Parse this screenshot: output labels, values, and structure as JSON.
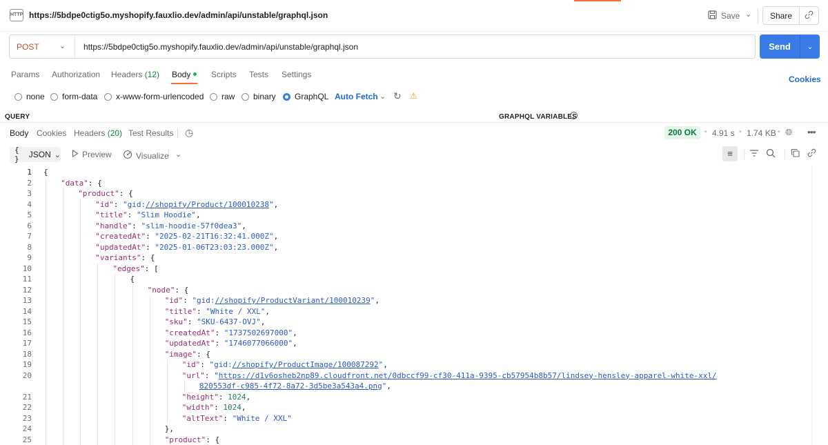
{
  "tab": {
    "icon_label": "HTTP",
    "title": "https://5bdpe0ctig5o.myshopify.fauxlio.dev/admin/api/unstable/graphql.json",
    "save_label": "Save",
    "share_label": "Share"
  },
  "request": {
    "method": "POST",
    "url": "https://5bdpe0ctig5o.myshopify.fauxlio.dev/admin/api/unstable/graphql.json",
    "send_label": "Send",
    "tabs": [
      {
        "label": "Params",
        "count": ""
      },
      {
        "label": "Authorization",
        "count": ""
      },
      {
        "label": "Headers",
        "count": "(12)"
      },
      {
        "label": "Body",
        "count": ""
      },
      {
        "label": "Scripts",
        "count": ""
      },
      {
        "label": "Tests",
        "count": ""
      },
      {
        "label": "Settings",
        "count": ""
      }
    ],
    "cookies_label": "Cookies",
    "body_types": [
      "none",
      "form-data",
      "x-www-form-urlencoded",
      "raw",
      "binary",
      "GraphQL"
    ],
    "selected_body_type": "GraphQL",
    "auto_fetch_label": "Auto Fetch"
  },
  "sections": {
    "query": "QUERY",
    "graphql_variables": "GRAPHQL VARIABLES"
  },
  "response": {
    "tabs": [
      {
        "label": "Body",
        "count": ""
      },
      {
        "label": "Cookies",
        "count": ""
      },
      {
        "label": "Headers",
        "count": "(20)"
      },
      {
        "label": "Test Results",
        "count": ""
      }
    ],
    "status": "200 OK",
    "time": "4.91 s",
    "size": "1.74 KB",
    "format_label": "JSON",
    "preview_label": "Preview",
    "visualize_label": "Visualize"
  },
  "colors": {
    "accent": "#ff6c37",
    "send": "#3b7be8",
    "status_ok": "#0a7a36"
  },
  "code_lines": [
    {
      "n": "1",
      "indent": 0,
      "parts": [
        [
          "p",
          "{"
        ]
      ]
    },
    {
      "n": "2",
      "indent": 1,
      "parts": [
        [
          "k",
          "\"data\""
        ],
        [
          "p",
          ": {"
        ]
      ]
    },
    {
      "n": "3",
      "indent": 2,
      "parts": [
        [
          "k",
          "\"product\""
        ],
        [
          "p",
          ": {"
        ]
      ]
    },
    {
      "n": "4",
      "indent": 3,
      "parts": [
        [
          "k",
          "\"id\""
        ],
        [
          "p",
          ": "
        ],
        [
          "s",
          "\"gid:"
        ],
        [
          "l",
          "//shopify/Product/100010238"
        ],
        [
          "s",
          "\""
        ],
        [
          "p",
          ","
        ]
      ]
    },
    {
      "n": "5",
      "indent": 3,
      "parts": [
        [
          "k",
          "\"title\""
        ],
        [
          "p",
          ": "
        ],
        [
          "s",
          "\"Slim Hoodie\""
        ],
        [
          "p",
          ","
        ]
      ]
    },
    {
      "n": "6",
      "indent": 3,
      "parts": [
        [
          "k",
          "\"handle\""
        ],
        [
          "p",
          ": "
        ],
        [
          "s",
          "\"slim-hoodie-57f0dea3\""
        ],
        [
          "p",
          ","
        ]
      ]
    },
    {
      "n": "7",
      "indent": 3,
      "parts": [
        [
          "k",
          "\"createdAt\""
        ],
        [
          "p",
          ": "
        ],
        [
          "s",
          "\"2025-02-21T16:32:41.000Z\""
        ],
        [
          "p",
          ","
        ]
      ]
    },
    {
      "n": "8",
      "indent": 3,
      "parts": [
        [
          "k",
          "\"updatedAt\""
        ],
        [
          "p",
          ": "
        ],
        [
          "s",
          "\"2025-01-06T23:03:23.000Z\""
        ],
        [
          "p",
          ","
        ]
      ]
    },
    {
      "n": "9",
      "indent": 3,
      "parts": [
        [
          "k",
          "\"variants\""
        ],
        [
          "p",
          ": {"
        ]
      ]
    },
    {
      "n": "10",
      "indent": 4,
      "parts": [
        [
          "k",
          "\"edges\""
        ],
        [
          "p",
          ": ["
        ]
      ]
    },
    {
      "n": "11",
      "indent": 5,
      "parts": [
        [
          "p",
          "{"
        ]
      ]
    },
    {
      "n": "12",
      "indent": 6,
      "parts": [
        [
          "k",
          "\"node\""
        ],
        [
          "p",
          ": {"
        ]
      ]
    },
    {
      "n": "13",
      "indent": 7,
      "parts": [
        [
          "k",
          "\"id\""
        ],
        [
          "p",
          ": "
        ],
        [
          "s",
          "\"gid:"
        ],
        [
          "l",
          "//shopify/ProductVariant/100010239"
        ],
        [
          "s",
          "\""
        ],
        [
          "p",
          ","
        ]
      ]
    },
    {
      "n": "14",
      "indent": 7,
      "parts": [
        [
          "k",
          "\"title\""
        ],
        [
          "p",
          ": "
        ],
        [
          "s",
          "\"White / XXL\""
        ],
        [
          "p",
          ","
        ]
      ]
    },
    {
      "n": "15",
      "indent": 7,
      "parts": [
        [
          "k",
          "\"sku\""
        ],
        [
          "p",
          ": "
        ],
        [
          "s",
          "\"SKU-6437-OVJ\""
        ],
        [
          "p",
          ","
        ]
      ]
    },
    {
      "n": "16",
      "indent": 7,
      "parts": [
        [
          "k",
          "\"createdAt\""
        ],
        [
          "p",
          ": "
        ],
        [
          "s",
          "\"1737502697000\""
        ],
        [
          "p",
          ","
        ]
      ]
    },
    {
      "n": "17",
      "indent": 7,
      "parts": [
        [
          "k",
          "\"updatedAt\""
        ],
        [
          "p",
          ": "
        ],
        [
          "s",
          "\"1746077066000\""
        ],
        [
          "p",
          ","
        ]
      ]
    },
    {
      "n": "18",
      "indent": 7,
      "parts": [
        [
          "k",
          "\"image\""
        ],
        [
          "p",
          ": {"
        ]
      ]
    },
    {
      "n": "19",
      "indent": 8,
      "parts": [
        [
          "k",
          "\"id\""
        ],
        [
          "p",
          ": "
        ],
        [
          "s",
          "\"gid:"
        ],
        [
          "l",
          "//shopify/ProductImage/100087292"
        ],
        [
          "s",
          "\""
        ],
        [
          "p",
          ","
        ]
      ]
    },
    {
      "n": "20",
      "indent": 8,
      "parts": [
        [
          "k",
          "\"url\""
        ],
        [
          "p",
          ": "
        ],
        [
          "s",
          "\""
        ],
        [
          "l",
          "https://d1v6osheb2np89.cloudfront.net/0dbccf99-cf30-411a-9395-cb57954b8b57/lindsey-hensley-apparel-white-xxl/"
        ]
      ]
    },
    {
      "n": "",
      "indent": 9,
      "parts": [
        [
          "l",
          "820553df-c985-4f72-8a72-3d5be3a543a4.png"
        ],
        [
          "s",
          "\""
        ],
        [
          "p",
          ","
        ]
      ]
    },
    {
      "n": "21",
      "indent": 8,
      "parts": [
        [
          "k",
          "\"height\""
        ],
        [
          "p",
          ": "
        ],
        [
          "d",
          "1024"
        ],
        [
          "p",
          ","
        ]
      ]
    },
    {
      "n": "22",
      "indent": 8,
      "parts": [
        [
          "k",
          "\"width\""
        ],
        [
          "p",
          ": "
        ],
        [
          "d",
          "1024"
        ],
        [
          "p",
          ","
        ]
      ]
    },
    {
      "n": "23",
      "indent": 8,
      "parts": [
        [
          "k",
          "\"altText\""
        ],
        [
          "p",
          ": "
        ],
        [
          "s",
          "\"White / XXL\""
        ]
      ]
    },
    {
      "n": "24",
      "indent": 7,
      "parts": [
        [
          "p",
          "},"
        ]
      ]
    },
    {
      "n": "25",
      "indent": 7,
      "parts": [
        [
          "k",
          "\"product\""
        ],
        [
          "p",
          ": {"
        ]
      ]
    }
  ]
}
